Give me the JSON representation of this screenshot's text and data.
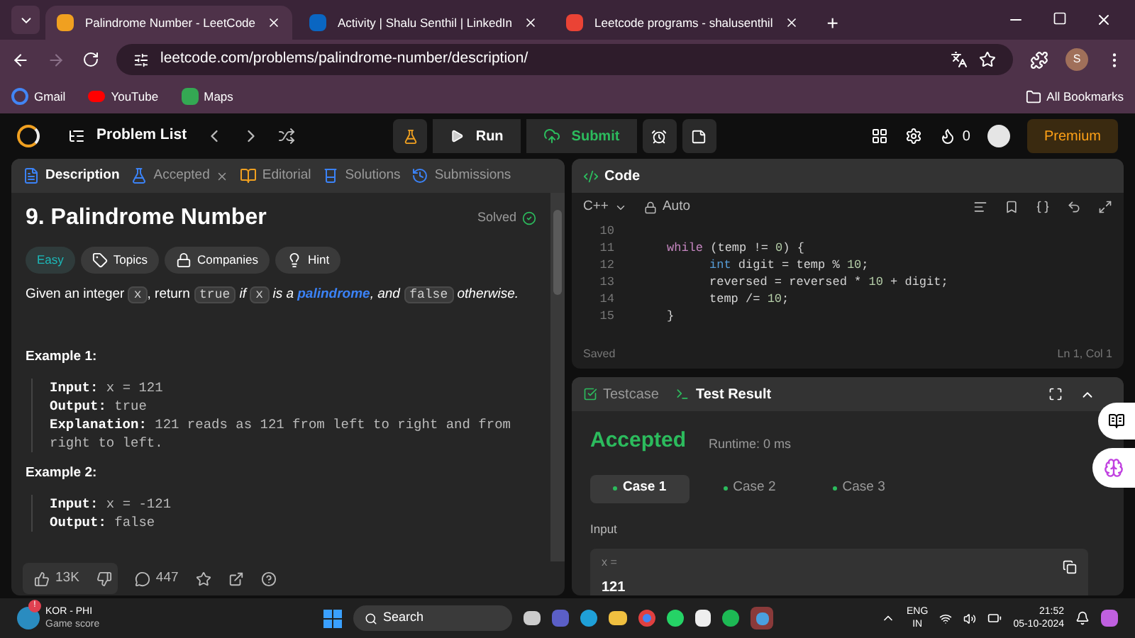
{
  "browser_tabs": [
    {
      "title": "Palindrome Number - LeetCode",
      "selected": true
    },
    {
      "title": "Activity | Shalu Senthil | LinkedIn",
      "selected": false
    },
    {
      "title": "Leetcode programs - shalusenthil",
      "selected": false
    }
  ],
  "new_tab": "+",
  "address": "leetcode.com/problems/palindrome-number/description/",
  "profile_initial": "S",
  "bookmarks": [
    {
      "label": "Gmail"
    },
    {
      "label": "YouTube"
    },
    {
      "label": "Maps"
    }
  ],
  "all_bookmarks": "All Bookmarks",
  "header": {
    "problem_list": "Problem List",
    "run": "Run",
    "submit": "Submit",
    "streak": "0",
    "premium": "Premium"
  },
  "left_tabs": [
    {
      "label": "Description",
      "selected": true,
      "closable": false
    },
    {
      "label": "Accepted",
      "selected": false,
      "closable": true
    },
    {
      "label": "Editorial",
      "selected": false,
      "closable": false
    },
    {
      "label": "Solutions",
      "selected": false,
      "closable": false
    },
    {
      "label": "Submissions",
      "selected": false,
      "closable": false
    }
  ],
  "problem": {
    "title": "9. Palindrome Number",
    "status": "Solved",
    "difficulty": "Easy",
    "chips": [
      {
        "label": "Topics"
      },
      {
        "label": "Companies"
      },
      {
        "label": "Hint"
      }
    ],
    "statement": [
      {
        "kind": "text",
        "t": "Given an integer "
      },
      {
        "kind": "code",
        "t": "x"
      },
      {
        "kind": "text",
        "t": ", return "
      },
      {
        "kind": "code",
        "t": "true"
      },
      {
        "kind": "italic",
        "t": " if "
      },
      {
        "kind": "code",
        "t": "x"
      },
      {
        "kind": "italic",
        "t": " is a "
      },
      {
        "kind": "link",
        "t": "palindrome"
      },
      {
        "kind": "italic",
        "t": ", and "
      },
      {
        "kind": "code",
        "t": "false"
      },
      {
        "kind": "italic",
        "t": " otherwise."
      }
    ],
    "examples": [
      {
        "title": "Example 1:",
        "lines": [
          {
            "label": "Input:",
            "value": "x = 121"
          },
          {
            "label": "Output:",
            "value": "true"
          },
          {
            "label": "Explanation:",
            "value": "121 reads as 121 from left to right and from right to left."
          }
        ]
      },
      {
        "title": "Example 2:",
        "lines": [
          {
            "label": "Input:",
            "value": "x = -121"
          },
          {
            "label": "Output:",
            "value": "false"
          }
        ]
      }
    ]
  },
  "footer": {
    "likes": "13K",
    "comments": "447"
  },
  "code": {
    "title": "Code",
    "language": "C++",
    "mode": "Auto",
    "status": "Saved",
    "cursor": "Ln 1, Col 1",
    "lines": [
      {
        "n": "10",
        "kind": "blank"
      },
      {
        "n": "11",
        "kind": "outer",
        "tokens": [
          {
            "kind": "keyword",
            "t": "while"
          },
          {
            "kind": "plain",
            "t": " (temp != "
          },
          {
            "kind": "number",
            "t": "0"
          },
          {
            "kind": "plain",
            "t": ") {"
          }
        ]
      },
      {
        "n": "12",
        "kind": "inner",
        "tokens": [
          {
            "kind": "type",
            "t": "int"
          },
          {
            "kind": "plain",
            "t": " digit = temp % "
          },
          {
            "kind": "number",
            "t": "10"
          },
          {
            "kind": "plain",
            "t": ";"
          }
        ]
      },
      {
        "n": "13",
        "kind": "inner",
        "tokens": [
          {
            "kind": "plain",
            "t": "reversed = reversed * "
          },
          {
            "kind": "number",
            "t": "10"
          },
          {
            "kind": "plain",
            "t": " + digit;"
          }
        ]
      },
      {
        "n": "14",
        "kind": "inner",
        "tokens": [
          {
            "kind": "plain",
            "t": "temp /= "
          },
          {
            "kind": "number",
            "t": "10"
          },
          {
            "kind": "plain",
            "t": ";"
          }
        ]
      },
      {
        "n": "15",
        "kind": "outer",
        "tokens": [
          {
            "kind": "plain",
            "t": "}"
          }
        ]
      }
    ]
  },
  "result_tabs": [
    {
      "label": "Testcase",
      "selected": false
    },
    {
      "label": "Test Result",
      "selected": true
    }
  ],
  "result": {
    "verdict": "Accepted",
    "runtime": "Runtime: 0 ms",
    "cases": [
      {
        "label": "Case 1",
        "selected": true
      },
      {
        "label": "Case 2",
        "selected": false
      },
      {
        "label": "Case 3",
        "selected": false
      }
    ],
    "input_label": "Input",
    "var": "x =",
    "value": "121"
  },
  "taskbar": {
    "widget_title": "KOR - PHI",
    "widget_sub": "Game score",
    "badge": "!",
    "search": "Search",
    "lang": "ENG",
    "region": "IN",
    "time": "21:52",
    "date": "05-10-2024"
  }
}
